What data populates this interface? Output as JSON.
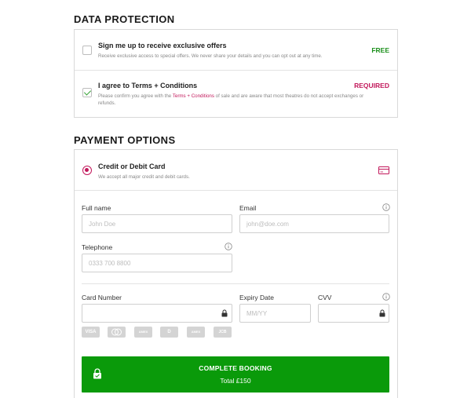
{
  "data_protection": {
    "title": "DATA PROTECTION",
    "offers": {
      "title": "Sign me up to receive exclusive offers",
      "description": "Receive exclusive access to special offers. We never share your details and you can opt out at any time.",
      "tag": "FREE",
      "checked": false
    },
    "terms": {
      "title": "I agree to Terms + Conditions",
      "description_before": "Please confirm you agree with the ",
      "link_text": "Terms + Conditions",
      "description_after": " of sale and are aware that most theatres do not accept exchanges or refunds.",
      "tag": "REQUIRED",
      "checked": true
    }
  },
  "payment": {
    "title": "PAYMENT OPTIONS",
    "method": {
      "title": "Credit or Debit Card",
      "description": "We accept all major credit and debit cards.",
      "selected": true
    },
    "fields": {
      "full_name": {
        "label": "Full name",
        "placeholder": "John Doe"
      },
      "email": {
        "label": "Email",
        "placeholder": "john@doe.com"
      },
      "telephone": {
        "label": "Telephone",
        "placeholder": "0333 700 8800"
      },
      "card_number": {
        "label": "Card Number",
        "placeholder": ""
      },
      "expiry": {
        "label": "Expiry Date",
        "placeholder": "MM/YY"
      },
      "cvv": {
        "label": "CVV",
        "placeholder": ""
      }
    },
    "card_brands": [
      "VISA",
      "MC",
      "AMEX",
      "D",
      "AMEX",
      "JCB"
    ],
    "cta": {
      "label": "COMPLETE BOOKING",
      "total": "Total £150",
      "color": "#0a9a0a"
    }
  },
  "colors": {
    "accent": "#c2185b",
    "free": "#1a8f1a"
  }
}
